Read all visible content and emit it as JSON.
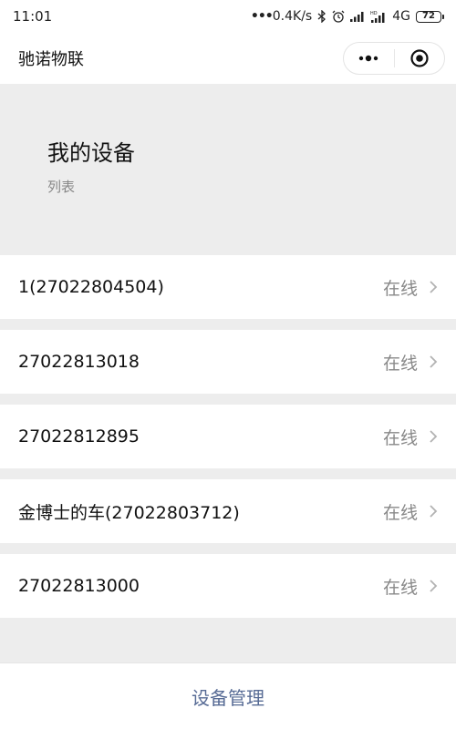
{
  "status_bar": {
    "time": "11:01",
    "network_speed": "0.4K/s",
    "network_type": "4G",
    "battery": "72",
    "icons": [
      "bluetooth-icon",
      "alarm-icon",
      "signal-icon",
      "hd-signal-icon",
      "battery-icon"
    ]
  },
  "nav": {
    "title": "驰诺物联",
    "more_icon": "more-dots-icon",
    "close_icon": "target-close-icon"
  },
  "header": {
    "title": "我的设备",
    "subtitle": "列表"
  },
  "devices": [
    {
      "name": "1(27022804504)",
      "status": "在线"
    },
    {
      "name": "27022813018",
      "status": "在线"
    },
    {
      "name": "27022812895",
      "status": "在线"
    },
    {
      "name": "金博士的车(27022803712)",
      "status": "在线"
    },
    {
      "name": "27022813000",
      "status": "在线"
    }
  ],
  "bottom": {
    "tab_label": "设备管理"
  },
  "colors": {
    "background": "#ededed",
    "link_blue": "#576b95",
    "muted_gray": "#888888"
  }
}
